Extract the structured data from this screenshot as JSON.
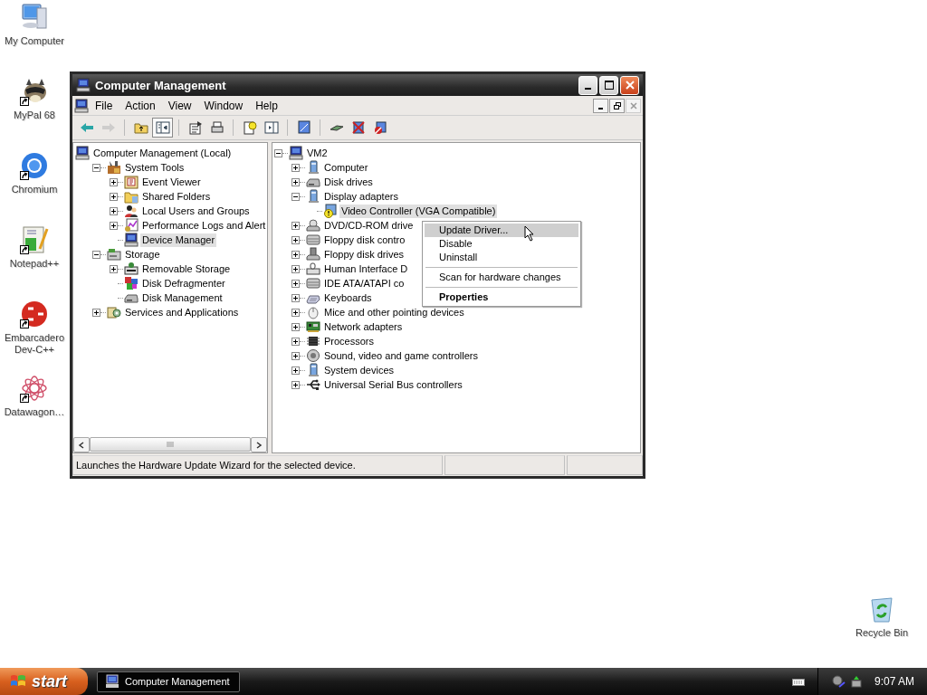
{
  "desktop_icons": [
    {
      "label": "My Computer",
      "shortcut": false
    },
    {
      "label": "MyPal 68",
      "shortcut": true
    },
    {
      "label": "Chromium",
      "shortcut": true
    },
    {
      "label": "Notepad++",
      "shortcut": true
    },
    {
      "label": "Embarcadero Dev-C++",
      "shortcut": true
    },
    {
      "label": "Datawagon…",
      "shortcut": true
    },
    {
      "label": "Recycle Bin",
      "shortcut": false
    }
  ],
  "window": {
    "title": "Computer Management",
    "menu": [
      "File",
      "Action",
      "View",
      "Window",
      "Help"
    ],
    "toolbar": [
      {
        "disabled": false,
        "pressed": false
      },
      {
        "disabled": true,
        "pressed": false
      },
      {
        "disabled": false,
        "pressed": false
      },
      {
        "disabled": false,
        "pressed": true
      },
      {
        "disabled": false,
        "pressed": false
      },
      {
        "disabled": false,
        "pressed": false
      },
      {
        "disabled": false,
        "pressed": false
      },
      {
        "disabled": false,
        "pressed": false
      },
      {
        "disabled": false,
        "pressed": false
      },
      {
        "disabled": false,
        "pressed": false
      },
      {
        "disabled": false,
        "pressed": false
      },
      {
        "disabled": false,
        "pressed": false
      }
    ],
    "console_tree": [
      {
        "label": "Computer Management (Local)",
        "selected": false,
        "children": [
          {
            "label": "System Tools",
            "expanded": true,
            "selected": false,
            "children": [
              {
                "label": "Event Viewer",
                "expanded": false,
                "selected": false
              },
              {
                "label": "Shared Folders",
                "expanded": false,
                "selected": false
              },
              {
                "label": "Local Users and Groups",
                "expanded": false,
                "selected": false
              },
              {
                "label": "Performance Logs and Alert",
                "expanded": false,
                "selected": false
              },
              {
                "label": "Device Manager",
                "selected": true
              }
            ]
          },
          {
            "label": "Storage",
            "expanded": true,
            "selected": false,
            "children": [
              {
                "label": "Removable Storage",
                "expanded": false,
                "selected": false
              },
              {
                "label": "Disk Defragmenter",
                "selected": false
              },
              {
                "label": "Disk Management",
                "selected": false
              }
            ]
          },
          {
            "label": "Services and Applications",
            "expanded": false,
            "selected": false
          }
        ]
      }
    ],
    "device_tree": [
      {
        "label": "VM2",
        "expanded": true,
        "selected": false,
        "children": [
          {
            "label": "Computer",
            "expanded": false,
            "selected": false
          },
          {
            "label": "Disk drives",
            "expanded": false,
            "selected": false
          },
          {
            "label": "Display adapters",
            "expanded": true,
            "selected": false,
            "children": [
              {
                "label": "Video Controller (VGA Compatible)",
                "selected": true
              }
            ]
          },
          {
            "label": "DVD/CD-ROM drive",
            "expanded": false,
            "selected": false
          },
          {
            "label": "Floppy disk contro",
            "expanded": false,
            "selected": false
          },
          {
            "label": "Floppy disk drives",
            "expanded": false,
            "selected": false
          },
          {
            "label": "Human Interface D",
            "expanded": false,
            "selected": false
          },
          {
            "label": "IDE ATA/ATAPI co",
            "expanded": false,
            "selected": false
          },
          {
            "label": "Keyboards",
            "expanded": false,
            "selected": false
          },
          {
            "label": "Mice and other pointing devices",
            "expanded": false,
            "selected": false
          },
          {
            "label": "Network adapters",
            "expanded": false,
            "selected": false
          },
          {
            "label": "Processors",
            "expanded": false,
            "selected": false
          },
          {
            "label": "Sound, video and game controllers",
            "expanded": false,
            "selected": false
          },
          {
            "label": "System devices",
            "expanded": false,
            "selected": false
          },
          {
            "label": "Universal Serial Bus controllers",
            "expanded": false,
            "selected": false
          }
        ]
      }
    ],
    "context_menu": [
      {
        "kind": "item",
        "label": "Update Driver...",
        "selected": true,
        "default": false
      },
      {
        "kind": "item",
        "label": "Disable",
        "selected": false,
        "default": false
      },
      {
        "kind": "item",
        "label": "Uninstall",
        "selected": false,
        "default": false
      },
      {
        "kind": "separator"
      },
      {
        "kind": "item",
        "label": "Scan for hardware changes",
        "selected": false,
        "default": false
      },
      {
        "kind": "separator"
      },
      {
        "kind": "item",
        "label": "Properties",
        "selected": false,
        "default": true
      }
    ],
    "status_bar": {
      "text": "Launches the Hardware Update Wizard for the selected device."
    }
  },
  "taskbar": {
    "start": "start",
    "tasks": [
      {
        "label": "Computer Management",
        "selected": true
      }
    ],
    "clock": "9:07 AM"
  }
}
